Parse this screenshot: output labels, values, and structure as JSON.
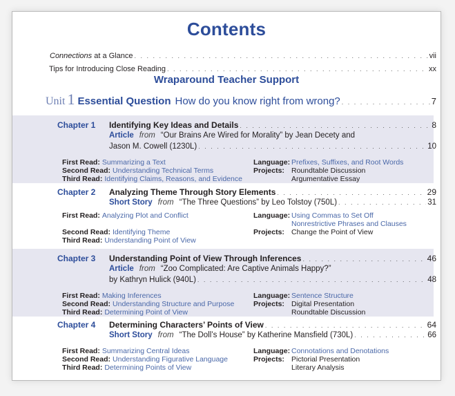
{
  "title": "Contents",
  "front_matter": [
    {
      "label_italic": "Connections",
      "label_rest": " at a Glance",
      "page": "vii"
    },
    {
      "label_italic": "",
      "label_rest": "Tips for Introducing Close Reading",
      "page": "xx"
    }
  ],
  "section_heading": "Wraparound Teacher Support",
  "unit": {
    "word": "Unit",
    "number": "1",
    "eq_label": "Essential Question",
    "question": "How do you know right from wrong?",
    "page": "7"
  },
  "chapters": [
    {
      "label": "Chapter 1",
      "title": "Identifying Key Ideas and Details",
      "page": "8",
      "selection": {
        "type": "Article",
        "from": "from",
        "line1": "“Our Brains Are Wired for Morality” by Jean Decety and",
        "line2": "Jason M. Cowell   (1230L)",
        "page": "10"
      },
      "reads": [
        {
          "key": "First Read:",
          "value": "Summarizing a Text"
        },
        {
          "key": "Second Read:",
          "value": "Understanding Technical Terms"
        },
        {
          "key": "Third Read:",
          "value": "Identifying Claims, Reasons, and Evidence"
        }
      ],
      "language_key": "Language:",
      "language": [
        "Prefixes, Suffixes, and Root Words"
      ],
      "projects_key": "Projects:",
      "projects": [
        "Roundtable Discussion",
        "Argumentative Essay"
      ]
    },
    {
      "label": "Chapter 2",
      "title": "Analyzing Theme Through Story Elements",
      "page": "29",
      "selection": {
        "type": "Short Story",
        "from": "from",
        "line1": "“The Three Questions” by Leo Tolstoy   (750L)",
        "line2": "",
        "page": "31"
      },
      "reads": [
        {
          "key": "First Read:",
          "value": "Analyzing Plot and Conflict"
        },
        {
          "key": "Second Read:",
          "value": "Identifying Theme"
        },
        {
          "key": "Third Read:",
          "value": "Understanding Point of View"
        }
      ],
      "language_key": "Language:",
      "language": [
        "Using Commas to Set Off",
        "Nonrestrictive Phrases and Clauses"
      ],
      "projects_key": "Projects:",
      "projects": [
        "Change the Point of View"
      ]
    },
    {
      "label": "Chapter 3",
      "title": "Understanding Point of View Through Inferences",
      "page": "46",
      "selection": {
        "type": "Article",
        "from": "from",
        "line1": "“Zoo Complicated: Are Captive Animals Happy?”",
        "line2": "by Kathryn Hulick   (940L)",
        "page": "48"
      },
      "reads": [
        {
          "key": "First Read:",
          "value": "Making Inferences"
        },
        {
          "key": "Second Read:",
          "value": "Understanding Structure and Purpose"
        },
        {
          "key": "Third Read:",
          "value": "Determining Point of View"
        }
      ],
      "language_key": "Language:",
      "language": [
        "Sentence Structure"
      ],
      "projects_key": "Projects:",
      "projects": [
        "Digital Presentation",
        "Roundtable Discussion"
      ]
    },
    {
      "label": "Chapter 4",
      "title": "Determining Characters’ Points of View",
      "page": "64",
      "selection": {
        "type": "Short Story",
        "from": "from",
        "line1": "“The Doll’s House” by Katherine Mansfield   (730L)",
        "line2": "",
        "page": "66"
      },
      "reads": [
        {
          "key": "First Read:",
          "value": "Summarizing Central Ideas"
        },
        {
          "key": "Second Read:",
          "value": "Understanding Figurative Language"
        },
        {
          "key": "Third Read:",
          "value": "Determining Points of View"
        }
      ],
      "language_key": "Language:",
      "language": [
        "Connotations and Denotations"
      ],
      "projects_key": "Projects:",
      "projects": [
        "Pictorial Presentation",
        "Literary Analysis"
      ]
    }
  ]
}
